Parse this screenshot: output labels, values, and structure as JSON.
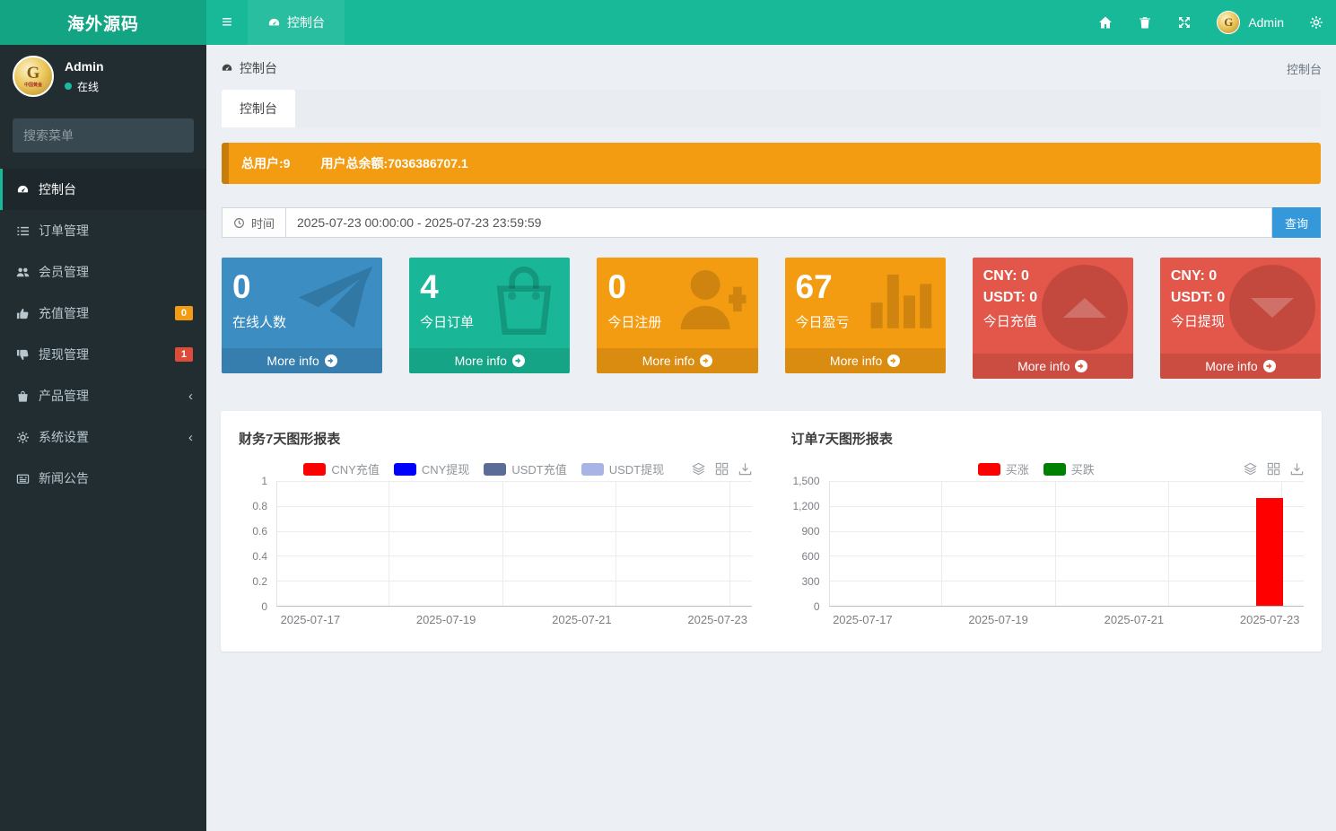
{
  "navbar": {
    "brand": "海外源码",
    "menu_tab": "控制台",
    "user_name": "Admin"
  },
  "sidebar": {
    "user_name": "Admin",
    "user_status": "在线",
    "search_placeholder": "搜索菜单",
    "items": [
      {
        "label": "控制台",
        "icon": "dashboard-icon",
        "active": true
      },
      {
        "label": "订单管理",
        "icon": "list-icon"
      },
      {
        "label": "会员管理",
        "icon": "users-icon"
      },
      {
        "label": "充值管理",
        "icon": "thumbs-up-icon",
        "badge": "0",
        "badge_color": "#f39c12"
      },
      {
        "label": "提现管理",
        "icon": "thumbs-down-icon",
        "badge": "1",
        "badge_color": "#dd4b39"
      },
      {
        "label": "产品管理",
        "icon": "shopping-bag-icon",
        "chevron": "‹"
      },
      {
        "label": "系统设置",
        "icon": "gears-icon",
        "chevron": "‹"
      },
      {
        "label": "新闻公告",
        "icon": "newspaper-icon"
      }
    ]
  },
  "content": {
    "breadcrumb": "控制台",
    "breadcrumb_right": "控制台",
    "tab_label": "控制台",
    "banner": {
      "total_users": "总用户:9",
      "total_balance": "用户总余额:7036386707.1",
      "color": "#f39c12"
    },
    "filter": {
      "label": "时间",
      "range": "2025-07-23 00:00:00 - 2025-07-23 23:59:59",
      "button": "查询",
      "button_color": "#3598db"
    }
  },
  "info_boxes": [
    {
      "value": "0",
      "label": "在线人数",
      "footer": "More info",
      "color": "#3b8dc2",
      "icon": "paper-plane-icon"
    },
    {
      "value": "4",
      "label": "今日订单",
      "footer": "More info",
      "color": "#19b797",
      "icon": "shopping-bag-icon"
    },
    {
      "value": "0",
      "label": "今日注册",
      "footer": "More info",
      "color": "#f39c12",
      "icon": "user-plus-icon"
    },
    {
      "value": "67",
      "label": "今日盈亏",
      "footer": "More info",
      "color": "#f39c12",
      "icon": "bar-chart-icon"
    },
    {
      "line1": "CNY: 0",
      "line2": "USDT: 0",
      "label": "今日充值",
      "footer": "More info",
      "color": "#e3564a",
      "icon": "caret-up-circle-icon"
    },
    {
      "line1": "CNY: 0",
      "line2": "USDT: 0",
      "label": "今日提现",
      "footer": "More info",
      "color": "#e3564a",
      "icon": "caret-down-circle-icon"
    }
  ],
  "chart_data": [
    {
      "type": "bar",
      "title": "财务7天图形报表",
      "categories": [
        "2025-07-17",
        "2025-07-18",
        "2025-07-19",
        "2025-07-20",
        "2025-07-21",
        "2025-07-22",
        "2025-07-23"
      ],
      "x_tick_labels": [
        "2025-07-17",
        "2025-07-19",
        "2025-07-21",
        "2025-07-23"
      ],
      "ylim": [
        0,
        1
      ],
      "yticks": [
        "1",
        "0.8",
        "0.6",
        "0.4",
        "0.2",
        "0"
      ],
      "grid": true,
      "legend_position": "top",
      "series": [
        {
          "name": "CNY充值",
          "color": "#ff0000",
          "values": [
            0,
            0,
            0,
            0,
            0,
            0,
            0
          ]
        },
        {
          "name": "CNY提现",
          "color": "#0000ff",
          "values": [
            0,
            0,
            0,
            0,
            0,
            0,
            0
          ]
        },
        {
          "name": "USDT充值",
          "color": "#5b6d97",
          "values": [
            0,
            0,
            0,
            0,
            0,
            0,
            0
          ]
        },
        {
          "name": "USDT提现",
          "color": "#a9b4e6",
          "values": [
            0,
            0,
            0,
            0,
            0,
            0,
            0
          ]
        }
      ]
    },
    {
      "type": "bar",
      "title": "订单7天图形报表",
      "categories": [
        "2025-07-17",
        "2025-07-18",
        "2025-07-19",
        "2025-07-20",
        "2025-07-21",
        "2025-07-22",
        "2025-07-23"
      ],
      "x_tick_labels": [
        "2025-07-17",
        "2025-07-19",
        "2025-07-21",
        "2025-07-23"
      ],
      "ylim": [
        0,
        1500
      ],
      "yticks": [
        "1,500",
        "1,200",
        "900",
        "600",
        "300",
        "0"
      ],
      "grid": true,
      "legend_position": "top",
      "series": [
        {
          "name": "买涨",
          "color": "#ff0000",
          "values": [
            0,
            0,
            0,
            0,
            0,
            0,
            1290
          ]
        },
        {
          "name": "买跌",
          "color": "#008000",
          "values": [
            0,
            0,
            0,
            0,
            0,
            0,
            0
          ]
        }
      ]
    }
  ]
}
